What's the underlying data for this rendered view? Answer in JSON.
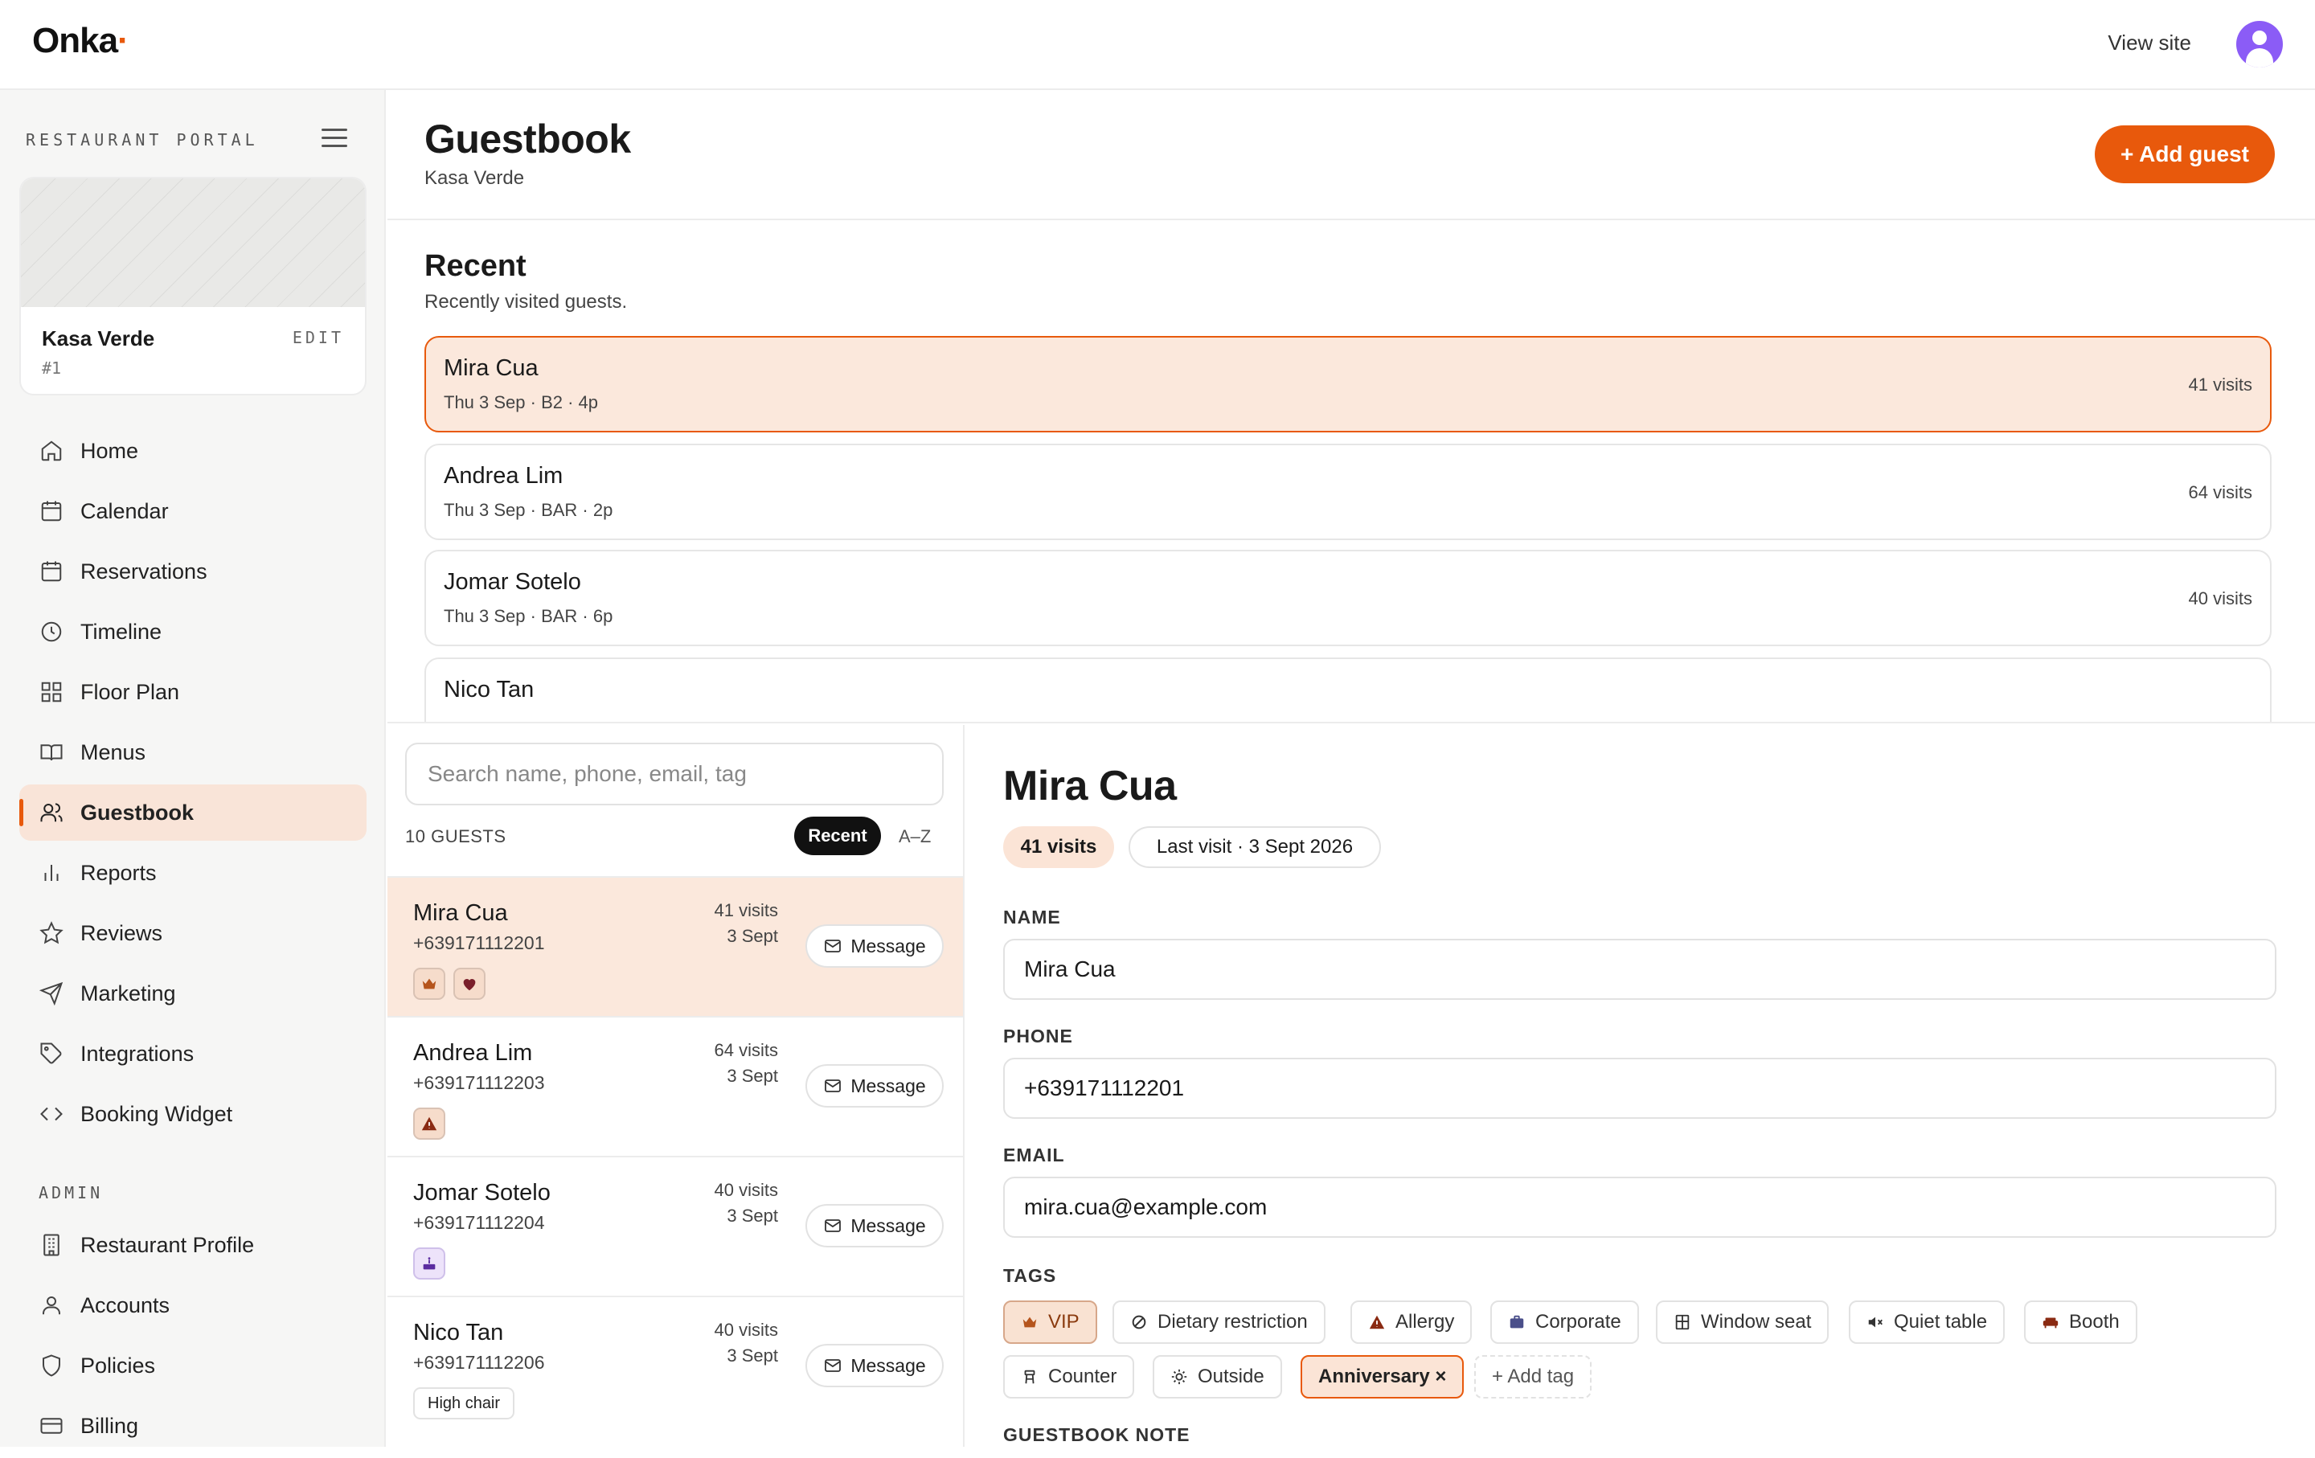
{
  "app": {
    "logo": "Onka",
    "view_site": "View site"
  },
  "sidebar": {
    "portal_label": "RESTAURANT PORTAL",
    "restaurant": {
      "name": "Kasa Verde",
      "edit": "EDIT",
      "id": "#1"
    },
    "items": [
      {
        "label": "Home",
        "icon": "home-icon"
      },
      {
        "label": "Calendar",
        "icon": "calendar-grid-icon"
      },
      {
        "label": "Reservations",
        "icon": "calendar-icon"
      },
      {
        "label": "Timeline",
        "icon": "clock-icon"
      },
      {
        "label": "Floor Plan",
        "icon": "grid-icon"
      },
      {
        "label": "Menus",
        "icon": "book-icon"
      },
      {
        "label": "Guestbook",
        "icon": "users-icon",
        "active": true
      },
      {
        "label": "Reports",
        "icon": "bar-chart-icon"
      },
      {
        "label": "Reviews",
        "icon": "star-icon"
      },
      {
        "label": "Marketing",
        "icon": "send-icon"
      },
      {
        "label": "Integrations",
        "icon": "tag-icon"
      },
      {
        "label": "Booking Widget",
        "icon": "code-icon"
      }
    ],
    "admin_label": "ADMIN",
    "admin_items": [
      {
        "label": "Restaurant Profile",
        "icon": "building-icon"
      },
      {
        "label": "Accounts",
        "icon": "user-icon"
      },
      {
        "label": "Policies",
        "icon": "shield-icon"
      },
      {
        "label": "Billing",
        "icon": "credit-card-icon"
      }
    ]
  },
  "header": {
    "title": "Guestbook",
    "subtitle": "Kasa Verde",
    "add_button": "+ Add guest"
  },
  "recent": {
    "title": "Recent",
    "subtitle": "Recently visited guests.",
    "items": [
      {
        "name": "Mira Cua",
        "detail": "Thu 3 Sep · B2 · 4p",
        "visits": "41 visits",
        "selected": true
      },
      {
        "name": "Andrea Lim",
        "detail": "Thu 3 Sep · BAR · 2p",
        "visits": "64 visits"
      },
      {
        "name": "Jomar Sotelo",
        "detail": "Thu 3 Sep · BAR · 6p",
        "visits": "40 visits"
      },
      {
        "name": "Nico Tan",
        "detail": "",
        "visits": ""
      }
    ]
  },
  "guest_list": {
    "search_placeholder": "Search name, phone, email, tag",
    "count": "10 GUESTS",
    "sort_recent": "Recent",
    "sort_az": "A–Z",
    "message_label": "Message",
    "guests": [
      {
        "name": "Mira Cua",
        "phone": "+639171112201",
        "visits": "41 visits",
        "date": "3 Sept",
        "selected": true
      },
      {
        "name": "Andrea Lim",
        "phone": "+639171112203",
        "visits": "64 visits",
        "date": "3 Sept"
      },
      {
        "name": "Jomar Sotelo",
        "phone": "+639171112204",
        "visits": "40 visits",
        "date": "3 Sept"
      },
      {
        "name": "Nico Tan",
        "phone": "+639171112206",
        "visits": "40 visits",
        "date": "3 Sept",
        "badge_text": "High chair"
      }
    ]
  },
  "detail": {
    "name": "Mira Cua",
    "visits_chip": "41 visits",
    "last_visit_chip": "Last visit · 3 Sept 2026",
    "name_label": "NAME",
    "name_value": "Mira Cua",
    "phone_label": "PHONE",
    "phone_value": "+639171112201",
    "email_label": "EMAIL",
    "email_value": "mira.cua@example.com",
    "tags_label": "TAGS",
    "tags": [
      {
        "label": "VIP",
        "icon": "crown-icon",
        "active": true
      },
      {
        "label": "Dietary restriction",
        "icon": "no-food-icon"
      },
      {
        "label": "Allergy",
        "icon": "warning-icon"
      },
      {
        "label": "Corporate",
        "icon": "briefcase-icon"
      },
      {
        "label": "Window seat",
        "icon": "window-icon"
      },
      {
        "label": "Quiet table",
        "icon": "mute-icon"
      },
      {
        "label": "Booth",
        "icon": "sofa-icon"
      },
      {
        "label": "Counter",
        "icon": "stool-icon"
      },
      {
        "label": "Outside",
        "icon": "sun-icon"
      },
      {
        "label": "Anniversary ×",
        "icon": "",
        "active": true
      },
      {
        "label": "+ Add tag",
        "icon": ""
      }
    ],
    "note_label": "GUESTBOOK NOTE"
  },
  "colors": {
    "accent": "#e8590c",
    "selected_bg": "#fbe8dc",
    "avatar": "#8b5cf6"
  }
}
